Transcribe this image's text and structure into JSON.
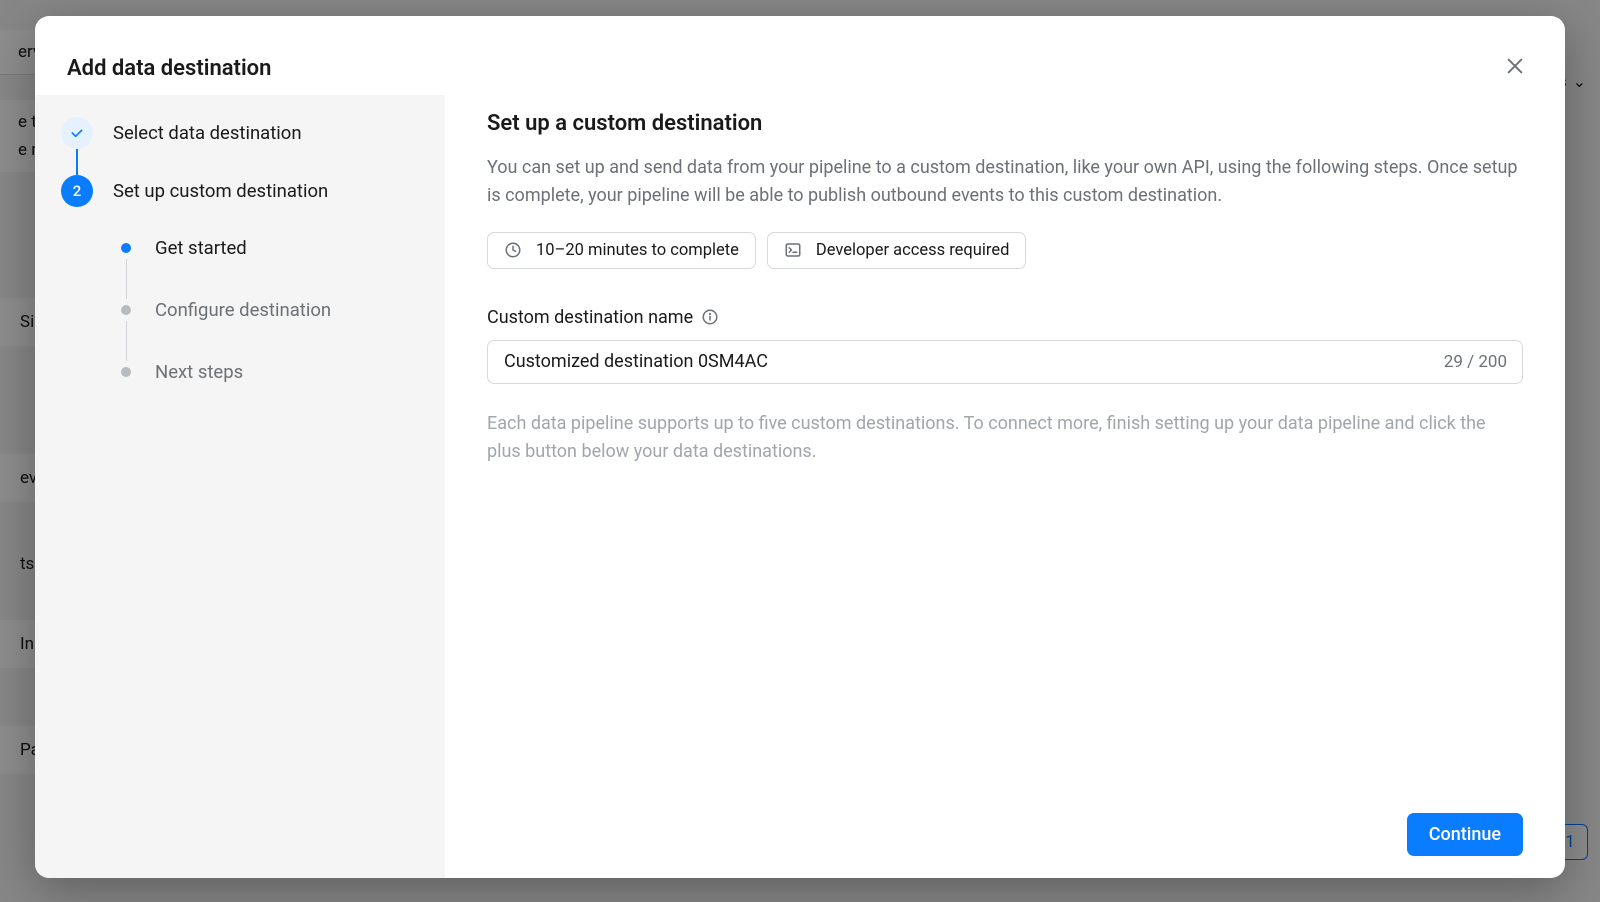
{
  "bg": {
    "left1": "ervi",
    "left2": "e the",
    "left3": "e rec",
    "left4": "Sig",
    "left5": "even",
    "left6": "ts",
    "left7": "Inp",
    "left8": "Pa",
    "dropdown": "ns",
    "page_num": "1"
  },
  "modal": {
    "title": "Add data destination",
    "steps": [
      {
        "label": "Select data destination",
        "state": "done"
      },
      {
        "label": "Set up custom destination",
        "state": "active",
        "number": "2"
      }
    ],
    "substeps": [
      {
        "label": "Get started",
        "state": "active"
      },
      {
        "label": "Configure destination",
        "state": "inactive"
      },
      {
        "label": "Next steps",
        "state": "inactive"
      }
    ],
    "main": {
      "heading": "Set up a custom destination",
      "description": "You can set up and send data from your pipeline to a custom destination, like your own API, using the following steps. Once setup is complete, your pipeline will be able to publish outbound events to this custom destination.",
      "time_badge": "10–20 minutes to complete",
      "access_badge": "Developer access required",
      "field_label": "Custom destination name",
      "input_value": "Customized destination 0SM4AC",
      "char_count": "29 / 200",
      "help_text": "Each data pipeline supports up to five custom destinations. To connect more, finish setting up your data pipeline and click the plus button below your data destinations.",
      "continue_label": "Continue"
    }
  }
}
